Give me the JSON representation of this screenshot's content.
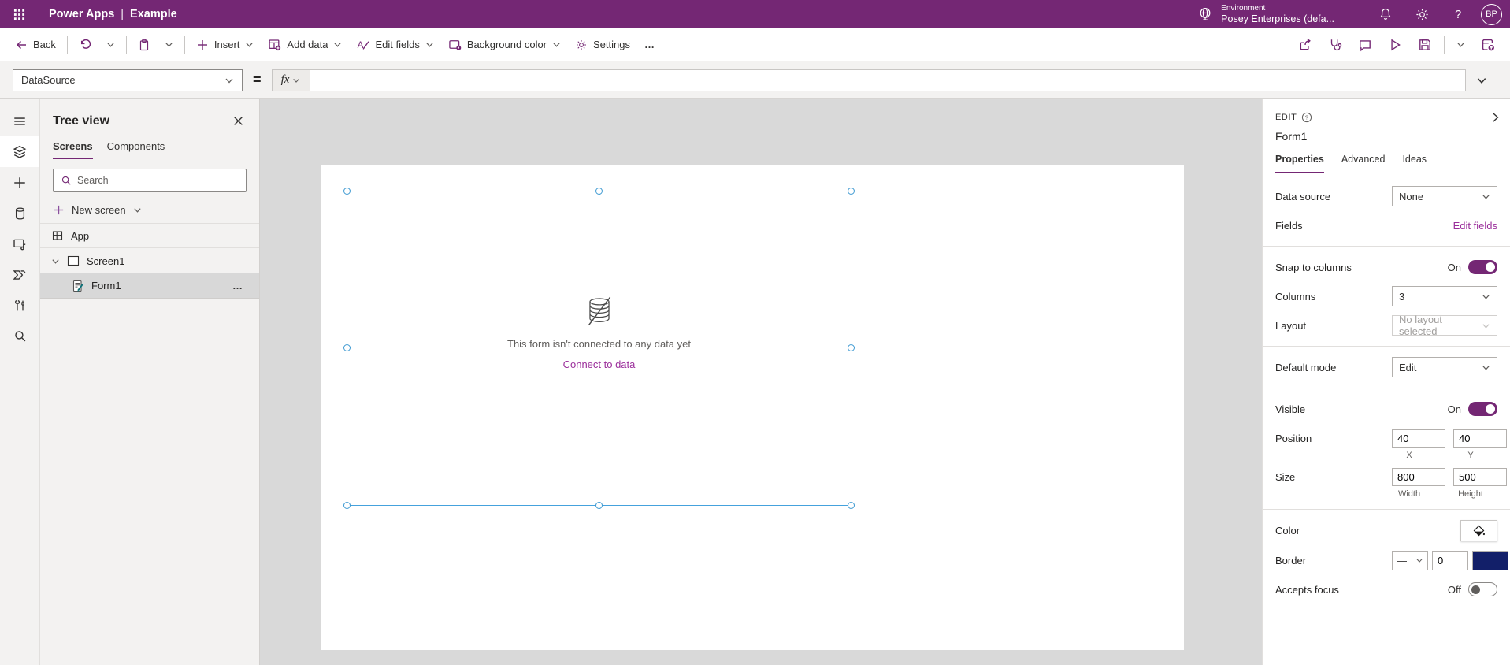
{
  "header": {
    "app_name": "Power Apps",
    "separator": "|",
    "doc_name": "Example",
    "environment_label": "Environment",
    "environment_name": "Posey Enterprises (defa...",
    "avatar_initials": "BP"
  },
  "toolbar": {
    "back_label": "Back",
    "insert_label": "Insert",
    "add_data_label": "Add data",
    "edit_fields_label": "Edit fields",
    "background_color_label": "Background color",
    "settings_label": "Settings",
    "more_label": "…"
  },
  "formula_bar": {
    "property_selected": "DataSource",
    "equals": "=",
    "fx_label": "fx",
    "formula_value": ""
  },
  "tree_view": {
    "title": "Tree view",
    "tabs": [
      "Screens",
      "Components"
    ],
    "search_placeholder": "Search",
    "new_screen_label": "New screen",
    "app_label": "App",
    "screen_label": "Screen1",
    "form_label": "Form1",
    "more_actions": "…"
  },
  "canvas": {
    "empty_message": "This form isn't connected to any data yet",
    "connect_link": "Connect to data"
  },
  "properties_panel": {
    "edit_label": "EDIT",
    "control_name": "Form1",
    "tabs": [
      "Properties",
      "Advanced",
      "Ideas"
    ],
    "data_source": {
      "label": "Data source",
      "value": "None"
    },
    "fields": {
      "label": "Fields",
      "link": "Edit fields"
    },
    "snap_to_columns": {
      "label": "Snap to columns",
      "state": "On"
    },
    "columns": {
      "label": "Columns",
      "value": "3"
    },
    "layout": {
      "label": "Layout",
      "value": "No layout selected"
    },
    "default_mode": {
      "label": "Default mode",
      "value": "Edit"
    },
    "visible": {
      "label": "Visible",
      "state": "On"
    },
    "position": {
      "label": "Position",
      "x": "40",
      "y": "40",
      "x_label": "X",
      "y_label": "Y"
    },
    "size": {
      "label": "Size",
      "width": "800",
      "height": "500",
      "width_label": "Width",
      "height_label": "Height"
    },
    "color": {
      "label": "Color"
    },
    "border": {
      "label": "Border",
      "style": "—",
      "thickness": "0"
    },
    "accepts_focus": {
      "label": "Accepts focus",
      "state": "Off"
    }
  },
  "colors": {
    "brand": "#742774",
    "selection_blue": "#45a2dd",
    "border_swatch": "#121f69",
    "link": "#9b2f9b"
  }
}
